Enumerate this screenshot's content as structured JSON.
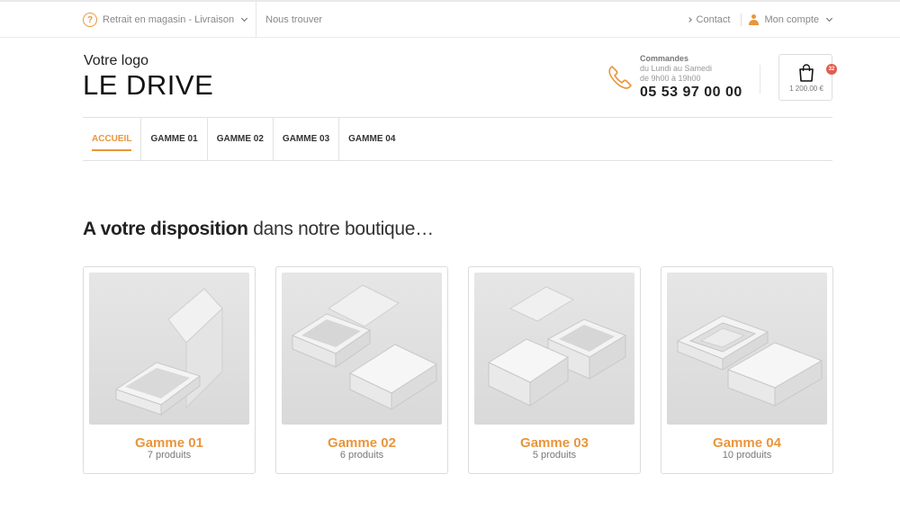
{
  "topbar": {
    "retrait_label": "Retrait en magasin - Livraison",
    "find_label": "Nous trouver",
    "contact_label": "Contact",
    "account_label": "Mon compte"
  },
  "header": {
    "logo_top": "Votre logo",
    "logo_main": "LE DRIVE",
    "orders_title": "Commandes",
    "orders_days": "du Lundi au Samedi",
    "orders_hours": "de 9h00 à 19h00",
    "phone": "05 53 97 00 00",
    "cart_count": "32",
    "cart_total": "1 200.00 €"
  },
  "nav": {
    "items": [
      {
        "label": "ACCUEIL",
        "active": true
      },
      {
        "label": "GAMME 01"
      },
      {
        "label": "GAMME 02"
      },
      {
        "label": "GAMME 03"
      },
      {
        "label": "GAMME 04"
      }
    ]
  },
  "main": {
    "title_bold": "A votre disposition",
    "title_light": " dans notre boutique…",
    "products": [
      {
        "name": "Gamme 01",
        "count": "7 produits"
      },
      {
        "name": "Gamme 02",
        "count": "6 produits"
      },
      {
        "name": "Gamme 03",
        "count": "5 produits"
      },
      {
        "name": "Gamme 04",
        "count": "10 produits"
      }
    ]
  },
  "colors": {
    "accent": "#e8963d",
    "badge": "#e55b4c"
  }
}
